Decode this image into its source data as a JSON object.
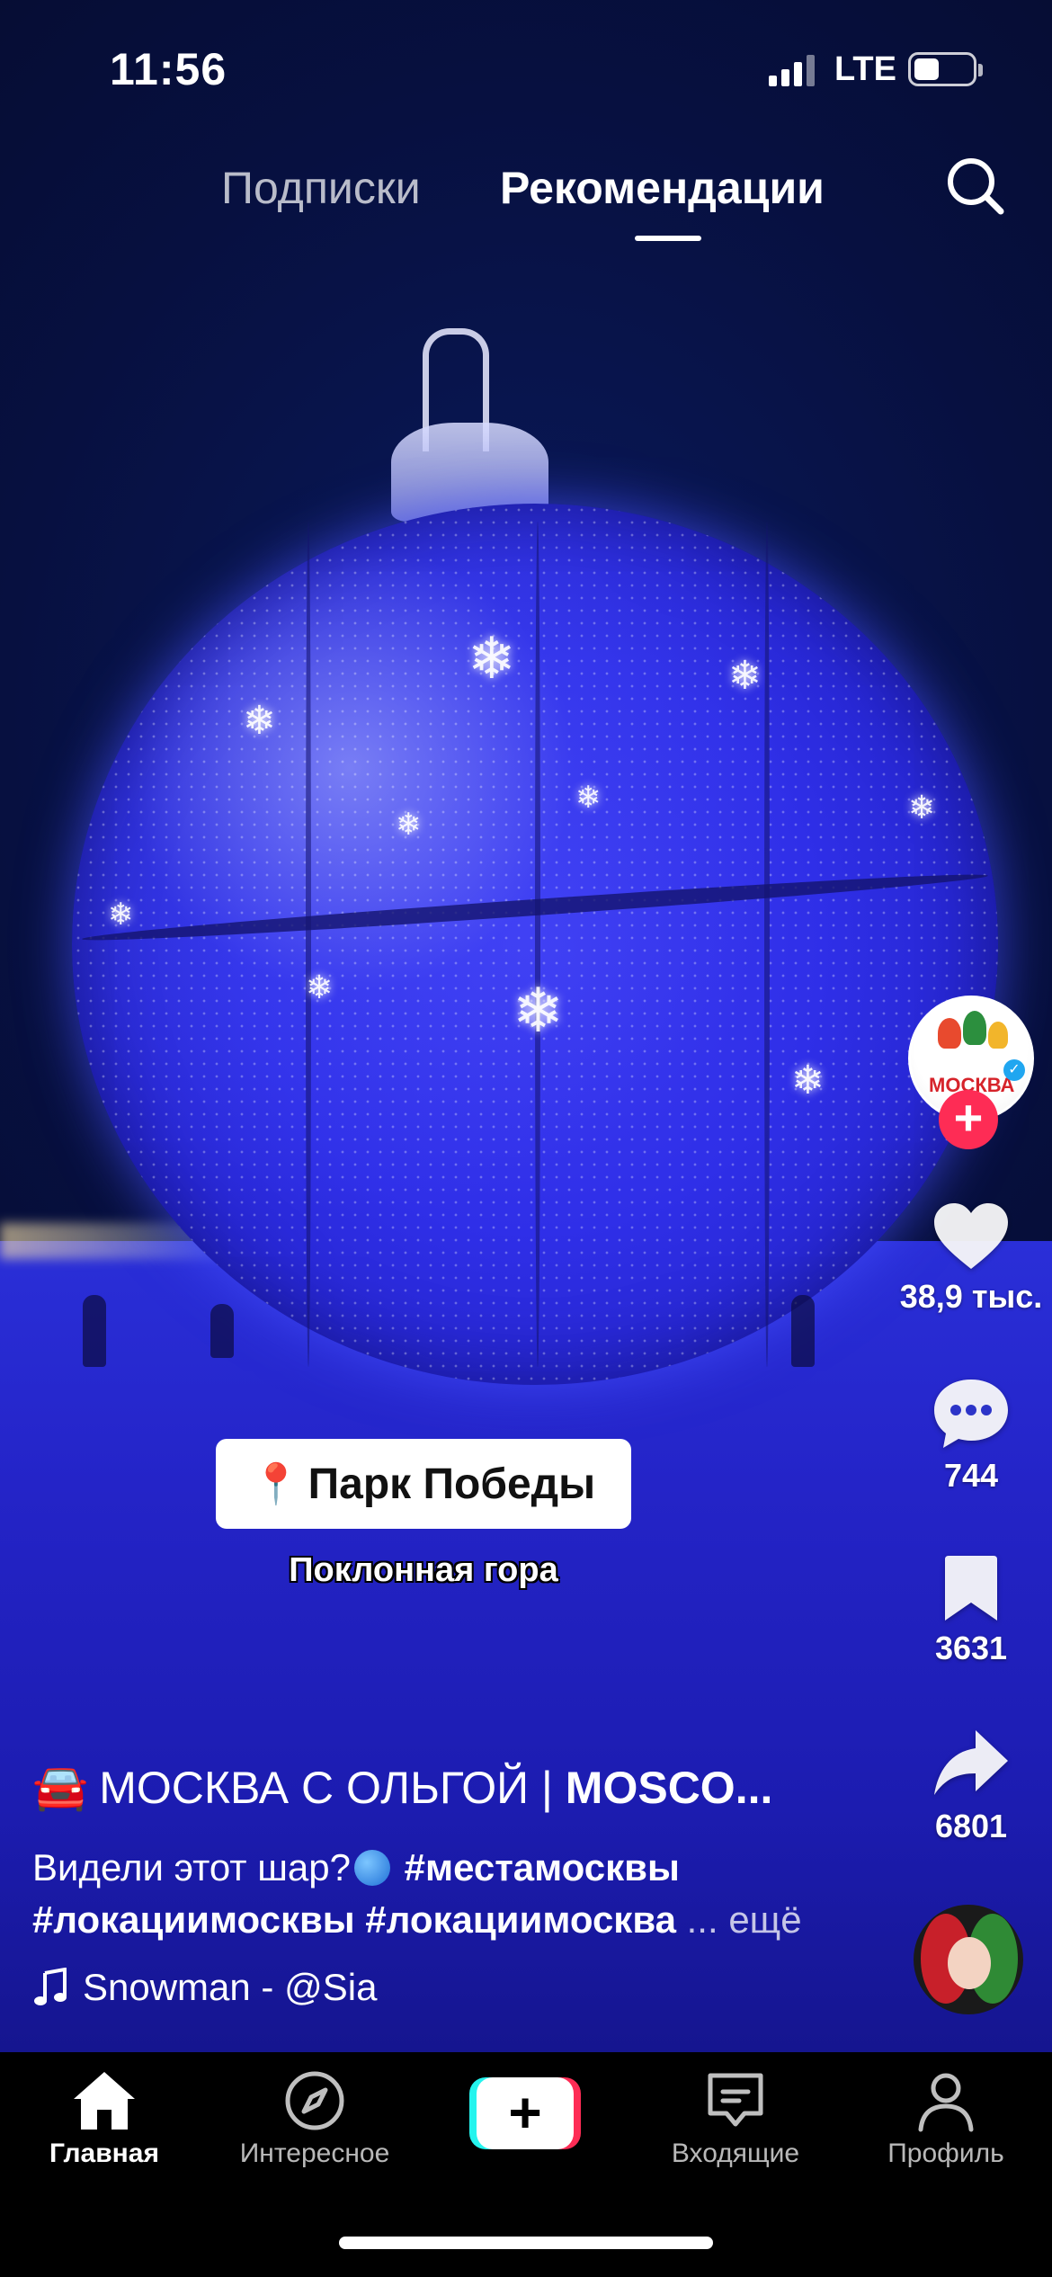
{
  "status_bar": {
    "time": "11:56",
    "network": "LTE",
    "battery_percent": 40
  },
  "top_tabs": {
    "following": "Подписки",
    "for_you": "Рекомендации",
    "active": "for_you"
  },
  "video": {
    "location_sticker": "Парк Победы",
    "location_subtitle": "Поклонная гора"
  },
  "rail": {
    "avatar_text": "МОСКВА",
    "likes": "38,9 тыс.",
    "comments": "744",
    "saves": "3631",
    "shares": "6801"
  },
  "caption": {
    "author_emoji": "🚘",
    "author_plain": "МОСКВА С ОЛЬГОЙ | ",
    "author_bold": "MOSCO...",
    "desc_text": "Видели этот шар?",
    "tag1": "#местамосквы",
    "tag2": "#локациимосквы",
    "tag3": "#локациимосква",
    "ellipsis": "...",
    "more": "ещё",
    "music": "Snowman - @Sia"
  },
  "nav": {
    "home": "Главная",
    "discover": "Интересное",
    "create": "+",
    "inbox": "Входящие",
    "profile": "Профиль",
    "active": "home"
  },
  "colors": {
    "accent": "#fe2c55",
    "cyan": "#25f4ee",
    "verified": "#20a6f0"
  }
}
